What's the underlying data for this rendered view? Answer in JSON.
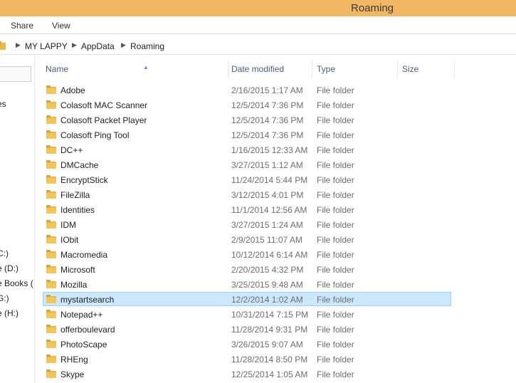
{
  "window": {
    "title": "Roaming"
  },
  "ribbon": {
    "tabs": [
      "Share",
      "View"
    ]
  },
  "address": {
    "crumbs": [
      "MY LAPPY",
      "AppData",
      "Roaming"
    ]
  },
  "nav": {
    "items": [
      "es",
      "C:)",
      "e (D:)",
      "e Books (",
      "G:)",
      "e (H:)"
    ]
  },
  "columns": {
    "name": "Name",
    "date": "Date modified",
    "type": "Type",
    "size": "Size"
  },
  "files": [
    {
      "name": "Adobe",
      "date": "2/16/2015 1:17 AM",
      "type": "File folder"
    },
    {
      "name": "Colasoft MAC Scanner",
      "date": "12/5/2014 7:36 PM",
      "type": "File folder"
    },
    {
      "name": "Colasoft Packet Player",
      "date": "12/5/2014 7:36 PM",
      "type": "File folder"
    },
    {
      "name": "Colasoft Ping Tool",
      "date": "12/5/2014 7:36 PM",
      "type": "File folder"
    },
    {
      "name": "DC++",
      "date": "1/16/2015 12:33 AM",
      "type": "File folder"
    },
    {
      "name": "DMCache",
      "date": "3/27/2015 1:12 AM",
      "type": "File folder"
    },
    {
      "name": "EncryptStick",
      "date": "11/24/2014 5:44 PM",
      "type": "File folder"
    },
    {
      "name": "FileZilla",
      "date": "3/12/2015 4:01 PM",
      "type": "File folder"
    },
    {
      "name": "Identities",
      "date": "11/1/2014 12:56 AM",
      "type": "File folder"
    },
    {
      "name": "IDM",
      "date": "3/27/2015 1:24 AM",
      "type": "File folder"
    },
    {
      "name": "IObit",
      "date": "2/9/2015 11:07 AM",
      "type": "File folder"
    },
    {
      "name": "Macromedia",
      "date": "10/12/2014 6:14 AM",
      "type": "File folder"
    },
    {
      "name": "Microsoft",
      "date": "2/20/2015 4:32 PM",
      "type": "File folder"
    },
    {
      "name": "Mozilla",
      "date": "3/25/2015 9:48 AM",
      "type": "File folder"
    },
    {
      "name": "mystartsearch",
      "date": "12/2/2014 1:02 AM",
      "type": "File folder",
      "selected": true
    },
    {
      "name": "Notepad++",
      "date": "10/31/2014 7:15 PM",
      "type": "File folder"
    },
    {
      "name": "offerboulevard",
      "date": "11/28/2014 9:31 PM",
      "type": "File folder"
    },
    {
      "name": "PhotoScape",
      "date": "3/26/2015 9:07 AM",
      "type": "File folder"
    },
    {
      "name": "RHEng",
      "date": "11/28/2014 8:50 PM",
      "type": "File folder"
    },
    {
      "name": "Skype",
      "date": "12/25/2014 1:05 AM",
      "type": "File folder"
    }
  ],
  "colors": {
    "titlebar": "#f1b762",
    "selection": "#cce8ff",
    "selection_border": "#99d1ff",
    "folder": "#e8b64a"
  }
}
